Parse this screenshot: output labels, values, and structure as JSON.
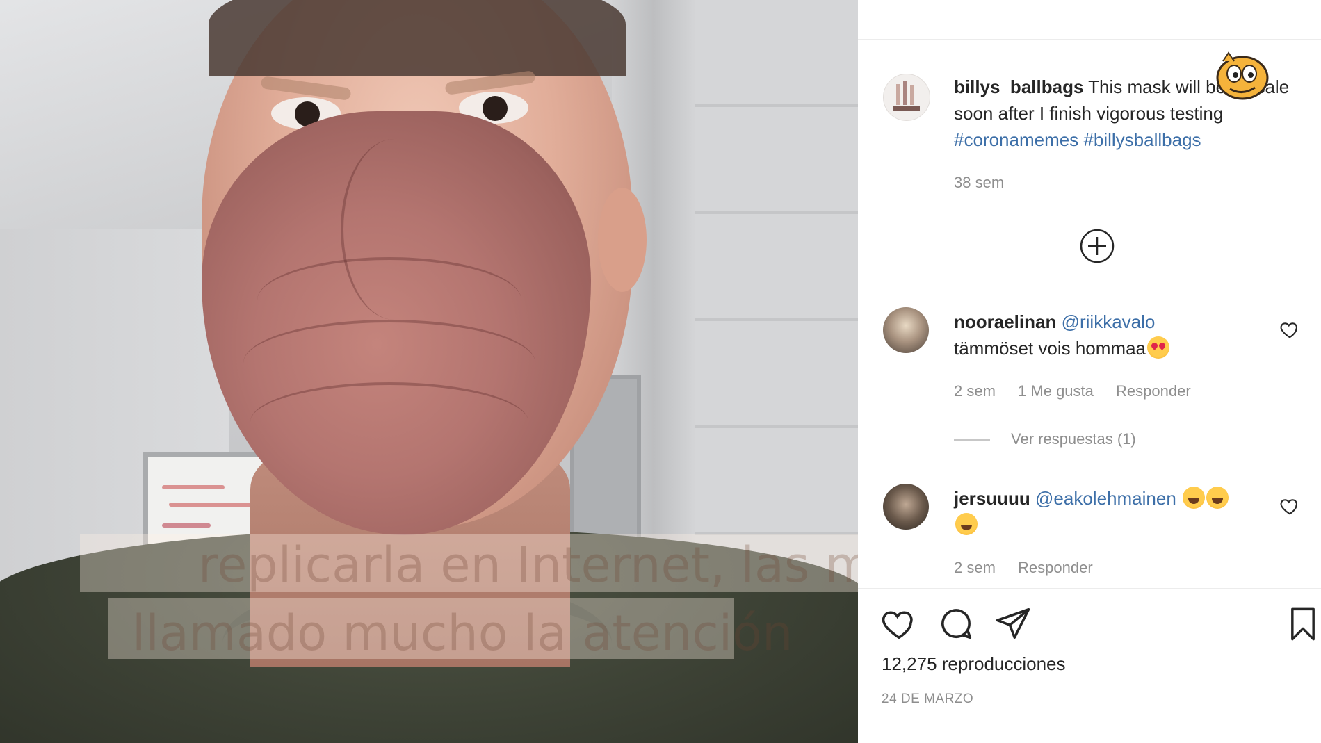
{
  "video": {
    "subtitle_line1": "replicarla en Internet, las m",
    "subtitle_line2": "llamado mucho la atención"
  },
  "post": {
    "author": "billys_ballbags",
    "caption_text": "This mask will be on sale soon after I finish vigorous testing",
    "hashtags": [
      "#coronamemes",
      "#billysballbags"
    ],
    "age": "38 sem",
    "load_more_icon": "plus-circle-icon"
  },
  "comments": [
    {
      "user": "nooraelinan",
      "mention": "@riikkavalo",
      "text": "tämmöset vois hommaa",
      "emoji": "heart-eyes-emoji",
      "age": "2 sem",
      "likes": "1 Me gusta",
      "reply": "Responder",
      "view_replies": "Ver respuestas (1)"
    },
    {
      "user": "jersuuuu",
      "mention": "@eakolehmainen",
      "emoji": "laughing-emoji",
      "age": "2 sem",
      "reply": "Responder"
    }
  ],
  "actions": {
    "like_icon": "heart-icon",
    "comment_icon": "comment-icon",
    "share_icon": "paper-plane-icon",
    "save_icon": "bookmark-icon"
  },
  "stats": {
    "views": "12,275 reproducciones",
    "date": "24 DE MARZO"
  },
  "colors": {
    "link": "#3d6fa8",
    "text": "#262626",
    "muted": "#8e8e8e"
  }
}
